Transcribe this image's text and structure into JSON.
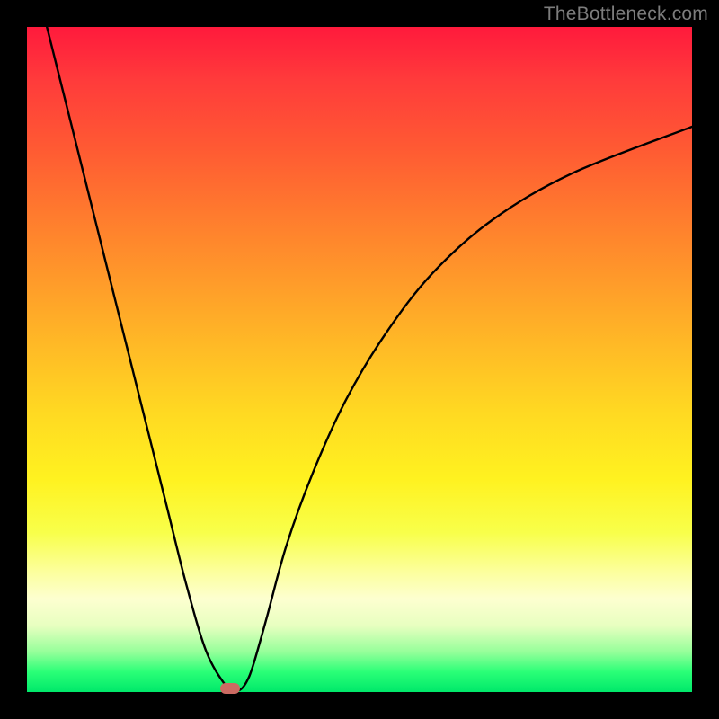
{
  "watermark": "TheBottleneck.com",
  "chart_data": {
    "type": "line",
    "title": "",
    "xlabel": "",
    "ylabel": "",
    "xlim": [
      0,
      100
    ],
    "ylim": [
      0,
      100
    ],
    "grid": false,
    "series": [
      {
        "name": "bottleneck-curve",
        "x": [
          3,
          6,
          9,
          12,
          15,
          18,
          21,
          24,
          27,
          30,
          31,
          32,
          33,
          34,
          36,
          39,
          43,
          48,
          54,
          61,
          70,
          82,
          100
        ],
        "values": [
          100,
          88,
          76,
          64,
          52,
          40,
          28,
          16,
          6,
          0.8,
          0.3,
          0.3,
          1.5,
          4,
          11,
          22,
          33,
          44,
          54,
          63,
          71,
          78,
          85
        ]
      }
    ],
    "marker": {
      "x": 30.5,
      "y": 0.5
    },
    "gradient_stops": [
      {
        "pct": 0,
        "color": "#ff1a3c"
      },
      {
        "pct": 50,
        "color": "#ffd922"
      },
      {
        "pct": 85,
        "color": "#fcff9e"
      },
      {
        "pct": 100,
        "color": "#00e86a"
      }
    ]
  }
}
